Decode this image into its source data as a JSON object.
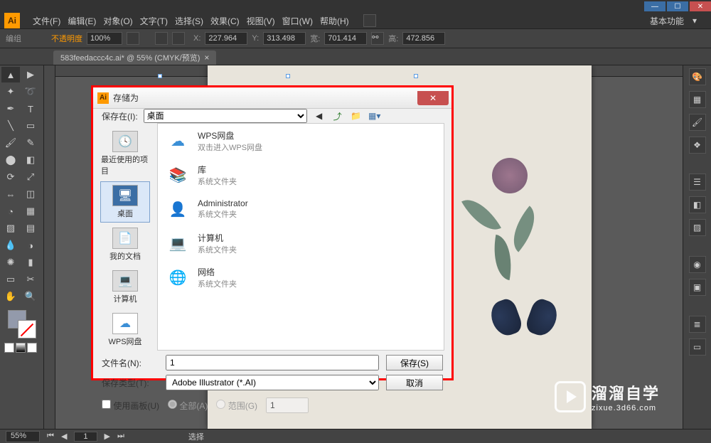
{
  "menu": {
    "items": [
      "文件(F)",
      "编辑(E)",
      "对象(O)",
      "文字(T)",
      "选择(S)",
      "效果(C)",
      "视图(V)",
      "窗口(W)",
      "帮助(H)"
    ],
    "right_label": "基本功能"
  },
  "control": {
    "group_label": "编组",
    "opacity_label": "不透明度",
    "opacity_value": "100%",
    "x_label": "X:",
    "x_value": "227.964",
    "y_label": "Y:",
    "y_value": "313.498",
    "w_label": "宽:",
    "w_value": "701.414",
    "h_label": "高:",
    "h_value": "472.856"
  },
  "tab": {
    "title": "583feedaccc4c.ai* @ 55% (CMYK/预览)"
  },
  "status": {
    "zoom": "55%",
    "mode": "选择"
  },
  "dialog": {
    "title": "存储为",
    "save_in_label": "保存在(I):",
    "save_in_value": "桌面",
    "sidebar": [
      {
        "label": "最近使用的项目"
      },
      {
        "label": "桌面"
      },
      {
        "label": "我的文档"
      },
      {
        "label": "计算机"
      },
      {
        "label": "WPS网盘"
      }
    ],
    "files": [
      {
        "name": "WPS网盘",
        "desc": "双击进入WPS网盘",
        "color": "#3b8fd6"
      },
      {
        "name": "库",
        "desc": "系统文件夹",
        "color": "#f0c060"
      },
      {
        "name": "Administrator",
        "desc": "系统文件夹",
        "color": "#f0c060"
      },
      {
        "name": "计算机",
        "desc": "系统文件夹",
        "color": "#6080a0"
      },
      {
        "name": "网络",
        "desc": "系统文件夹",
        "color": "#4a8a4a"
      }
    ],
    "filename_label": "文件名(N):",
    "filename_value": "1",
    "filetype_label": "保存类型(T):",
    "filetype_value": "Adobe Illustrator (*.AI)",
    "save_btn": "保存(S)",
    "cancel_btn": "取消",
    "use_artboard": "使用画板(U)",
    "all_label": "全部(A)",
    "range_label": "范围(G)",
    "range_value": "1"
  },
  "watermark": {
    "name": "溜溜自学",
    "url": "zixue.3d66.com"
  }
}
